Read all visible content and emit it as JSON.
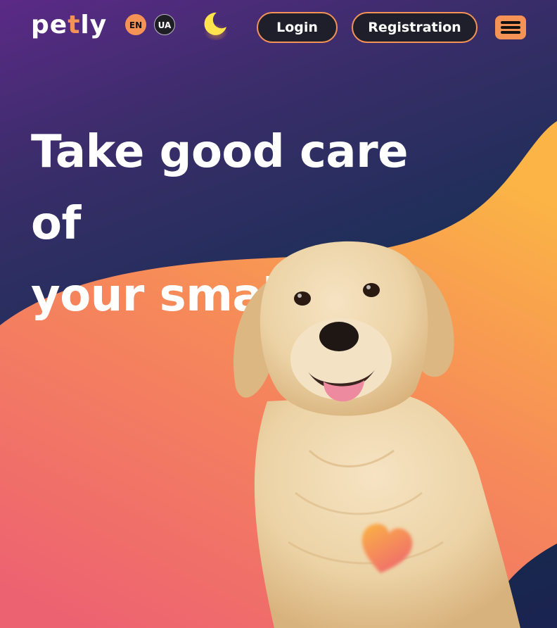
{
  "header": {
    "logo": {
      "prefix": "pe",
      "accent": "t",
      "suffix": "ly"
    },
    "languages": [
      "EN",
      "UA"
    ],
    "active_language": "EN",
    "theme_toggle_icon": "moon-icon",
    "login_label": "Login",
    "registration_label": "Registration",
    "menu_icon": "hamburger-menu-icon"
  },
  "hero": {
    "title_line1": "Take good care of",
    "title_line2": "your small pets",
    "image": "golden-retriever-dog",
    "decoration_icon": "heart-icon"
  },
  "colors": {
    "accent": "#f59256",
    "button_bg": "#1e1f2b",
    "moon": "#ffe44d",
    "wave_top": "#fbb445",
    "wave_bottom": "#ed6271"
  }
}
